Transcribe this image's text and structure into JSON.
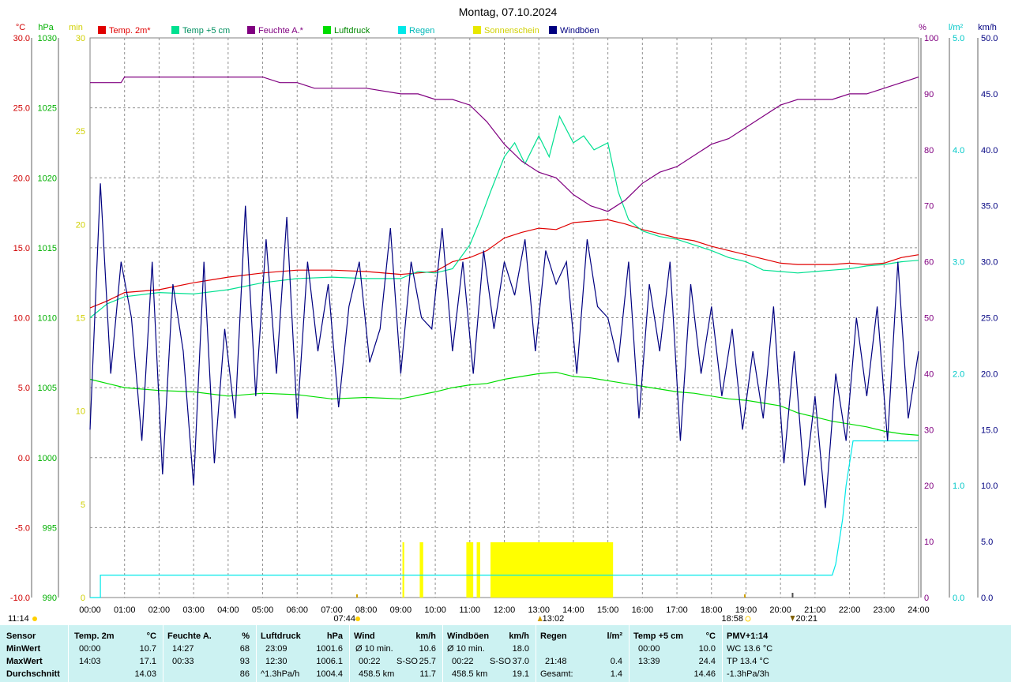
{
  "title": "Montag, 07.10.2024",
  "axis_units": {
    "temp": "°C",
    "pressure": "hPa",
    "sunshine": "min",
    "humidity": "%",
    "rain": "l/m²",
    "wind": "km/h"
  },
  "colors": {
    "temp2m": "#e00000",
    "temp5cm": "#00e090",
    "humidity": "#800080",
    "pressure": "#00dd00",
    "rain": "#00e8e8",
    "sunshine": "#ffff00",
    "wind": "#000080",
    "stats_bg": "#ccf2f2"
  },
  "chart_data": {
    "type": "line",
    "title": "Montag, 07.10.2024",
    "x_ticks": [
      "00:00",
      "01:00",
      "02:00",
      "03:00",
      "04:00",
      "05:00",
      "06:00",
      "07:00",
      "08:00",
      "09:00",
      "10:00",
      "11:00",
      "12:00",
      "13:00",
      "14:00",
      "15:00",
      "16:00",
      "17:00",
      "18:00",
      "19:00",
      "20:00",
      "21:00",
      "22:00",
      "23:00",
      "24:00"
    ],
    "xlim": [
      0,
      24
    ],
    "grid": true,
    "legend": [
      {
        "label": "Temp. 2m*",
        "color": "#e00000"
      },
      {
        "label": "Temp +5 cm",
        "color": "#00e090"
      },
      {
        "label": "Feuchte A.*",
        "color": "#800080"
      },
      {
        "label": "Luftdruck",
        "color": "#00dd00"
      },
      {
        "label": "Regen",
        "color": "#00e8e8"
      },
      {
        "label": "Sonnenschein",
        "color": "#e8e800"
      },
      {
        "label": "Windböen",
        "color": "#000080"
      }
    ],
    "axes": {
      "temp": {
        "unit": "°C",
        "ylim": [
          -10,
          30
        ],
        "ticks": [
          "30.0",
          "25.0",
          "20.0",
          "15.0",
          "10.0",
          "5.0",
          "0.0",
          "-5.0",
          "-10.0"
        ]
      },
      "pressure": {
        "unit": "hPa",
        "ylim": [
          990,
          1030
        ],
        "ticks": [
          "1030",
          "1025",
          "1020",
          "1015",
          "1010",
          "1005",
          "1000",
          "995",
          "990"
        ]
      },
      "sunshine": {
        "unit": "min",
        "ylim": [
          0,
          30
        ],
        "ticks": [
          "30",
          "25",
          "20",
          "15",
          "10",
          "5",
          "0"
        ]
      },
      "humidity": {
        "unit": "%",
        "ylim": [
          0,
          100
        ],
        "ticks": [
          "100",
          "90",
          "80",
          "70",
          "60",
          "50",
          "40",
          "30",
          "20",
          "10",
          "0"
        ]
      },
      "rain": {
        "unit": "l/m²",
        "ylim": [
          0,
          5
        ],
        "ticks": [
          "5.0",
          "4.0",
          "3.0",
          "2.0",
          "1.0",
          "0.0"
        ]
      },
      "wind": {
        "unit": "km/h",
        "ylim": [
          0,
          50
        ],
        "ticks": [
          "50.0",
          "45.0",
          "40.0",
          "35.0",
          "30.0",
          "25.0",
          "20.0",
          "15.0",
          "10.0",
          "5.0",
          "0.0"
        ]
      }
    },
    "series": [
      {
        "name": "Temp. 2m*",
        "axis": "temp",
        "x": [
          0,
          0.5,
          1,
          2,
          3,
          4,
          5,
          6,
          7,
          8,
          9,
          10,
          10.5,
          11,
          11.5,
          12,
          12.5,
          13,
          13.5,
          14,
          14.5,
          15,
          15.5,
          16,
          16.5,
          17,
          17.5,
          18,
          18.5,
          19,
          19.5,
          20,
          20.5,
          21,
          21.5,
          22,
          22.5,
          23,
          23.5,
          24
        ],
        "values": [
          10.7,
          11.2,
          11.8,
          12.0,
          12.5,
          12.9,
          13.2,
          13.4,
          13.4,
          13.3,
          13.1,
          13.3,
          14.0,
          14.3,
          14.8,
          15.7,
          16.1,
          16.4,
          16.3,
          16.8,
          16.9,
          17.0,
          16.7,
          16.3,
          16.0,
          15.7,
          15.5,
          15.1,
          14.8,
          14.5,
          14.2,
          13.9,
          13.8,
          13.8,
          13.8,
          13.9,
          13.8,
          13.9,
          14.3,
          14.5
        ]
      },
      {
        "name": "Temp +5 cm",
        "axis": "temp",
        "x": [
          0,
          0.5,
          1,
          2,
          3,
          4,
          5,
          6,
          7,
          8,
          9,
          9.5,
          10,
          10.5,
          11,
          11.3,
          11.6,
          12,
          12.3,
          12.6,
          13,
          13.3,
          13.6,
          14,
          14.3,
          14.6,
          15,
          15.3,
          15.6,
          16,
          16.5,
          17,
          17.5,
          18,
          18.5,
          19,
          19.5,
          20,
          20.5,
          21,
          21.5,
          22,
          22.5,
          23,
          23.5,
          24
        ],
        "values": [
          10.0,
          11.0,
          11.5,
          11.8,
          11.7,
          12.0,
          12.5,
          12.8,
          12.9,
          12.8,
          12.8,
          13.3,
          13.2,
          13.5,
          15.2,
          17.0,
          19.0,
          21.5,
          22.5,
          21.0,
          23.0,
          21.5,
          24.4,
          22.5,
          23.0,
          22.0,
          22.5,
          19.0,
          17.0,
          16.2,
          15.8,
          15.6,
          15.2,
          14.8,
          14.3,
          14.0,
          13.4,
          13.3,
          13.2,
          13.3,
          13.4,
          13.5,
          13.7,
          13.8,
          14.0,
          14.1
        ]
      },
      {
        "name": "Feuchte A.*",
        "axis": "humidity",
        "x": [
          0,
          0.5,
          0.9,
          1,
          2,
          3,
          4,
          5,
          5.5,
          6,
          6.5,
          7,
          8,
          9,
          9.5,
          10,
          10.5,
          11,
          11.5,
          12,
          12.5,
          13,
          13.5,
          14,
          14.5,
          15,
          15.5,
          16,
          16.5,
          17,
          17.5,
          18,
          18.5,
          19,
          19.5,
          20,
          20.5,
          21,
          21.5,
          22,
          22.5,
          23,
          23.5,
          24
        ],
        "values": [
          92,
          92,
          92,
          93,
          93,
          93,
          93,
          93,
          92,
          92,
          91,
          91,
          91,
          90,
          90,
          89,
          89,
          88,
          85,
          81,
          78,
          76,
          75,
          72,
          70,
          69,
          71,
          74,
          76,
          77,
          79,
          81,
          82,
          84,
          86,
          88,
          89,
          89,
          89,
          90,
          90,
          91,
          92,
          93
        ]
      },
      {
        "name": "Luftdruck",
        "axis": "pressure",
        "x": [
          0,
          0.5,
          1,
          2,
          3,
          4,
          5,
          6,
          7,
          8,
          9,
          10,
          10.5,
          11,
          11.5,
          12,
          12.5,
          13,
          13.5,
          14,
          14.5,
          15,
          15.5,
          16,
          16.5,
          17,
          17.5,
          18,
          18.5,
          19,
          19.5,
          20,
          20.5,
          21,
          21.5,
          22,
          22.5,
          23,
          23.5,
          24
        ],
        "values": [
          1005.6,
          1005.3,
          1005.0,
          1004.8,
          1004.7,
          1004.4,
          1004.6,
          1004.5,
          1004.2,
          1004.3,
          1004.2,
          1004.7,
          1005.0,
          1005.2,
          1005.3,
          1005.6,
          1005.8,
          1006.0,
          1006.1,
          1005.8,
          1005.7,
          1005.5,
          1005.3,
          1005.1,
          1004.9,
          1004.7,
          1004.6,
          1004.4,
          1004.2,
          1004.1,
          1003.9,
          1003.7,
          1003.2,
          1002.9,
          1002.6,
          1002.4,
          1002.2,
          1001.9,
          1001.7,
          1001.6
        ]
      },
      {
        "name": "Regen",
        "axis": "rain",
        "x": [
          0,
          0.3,
          0.3,
          21.5,
          21.6,
          21.7,
          21.8,
          21.9,
          22.0,
          22.1,
          24
        ],
        "values": [
          0,
          0,
          0.2,
          0.2,
          0.3,
          0.5,
          0.7,
          1.0,
          1.2,
          1.4,
          1.4
        ]
      },
      {
        "name": "Windböen",
        "axis": "wind",
        "x": [
          0,
          0.3,
          0.6,
          0.9,
          1.2,
          1.5,
          1.8,
          2.1,
          2.4,
          2.7,
          3.0,
          3.3,
          3.6,
          3.9,
          4.2,
          4.5,
          4.8,
          5.1,
          5.4,
          5.7,
          6.0,
          6.3,
          6.6,
          6.9,
          7.2,
          7.5,
          7.8,
          8.1,
          8.4,
          8.7,
          9.0,
          9.3,
          9.6,
          9.9,
          10.2,
          10.5,
          10.8,
          11.1,
          11.4,
          11.7,
          12.0,
          12.3,
          12.6,
          12.9,
          13.2,
          13.5,
          13.8,
          14.1,
          14.4,
          14.7,
          15.0,
          15.3,
          15.6,
          15.9,
          16.2,
          16.5,
          16.8,
          17.1,
          17.4,
          17.7,
          18.0,
          18.3,
          18.6,
          18.9,
          19.2,
          19.5,
          19.8,
          20.1,
          20.4,
          20.7,
          21.0,
          21.3,
          21.6,
          21.9,
          22.2,
          22.5,
          22.8,
          23.1,
          23.4,
          23.7,
          24
        ],
        "values": [
          15,
          37,
          20,
          30,
          25,
          14,
          30,
          11,
          28,
          22,
          10,
          30,
          12,
          24,
          16,
          35,
          18,
          32,
          20,
          34,
          16,
          30,
          22,
          28,
          17,
          26,
          30,
          21,
          24,
          33,
          20,
          30,
          25,
          24,
          33,
          22,
          30,
          20,
          31,
          24,
          30,
          27,
          32,
          22,
          31,
          28,
          30,
          20,
          32,
          26,
          25,
          21,
          30,
          16,
          28,
          22,
          30,
          14,
          28,
          20,
          26,
          18,
          24,
          15,
          22,
          16,
          26,
          12,
          22,
          10,
          18,
          8,
          20,
          14,
          25,
          18,
          26,
          14,
          30,
          16,
          22
        ]
      }
    ],
    "sunshine": {
      "axis": "sunshine",
      "x_ranges": [
        [
          9.05,
          9.1
        ],
        [
          9.55,
          9.65
        ],
        [
          10.9,
          11.1
        ],
        [
          11.2,
          11.3
        ],
        [
          11.6,
          15.15
        ]
      ],
      "value": 1
    },
    "markers": {
      "sunrise": "07:44",
      "sunset": "18:58",
      "noon": "13:02",
      "moon": "20:21"
    }
  },
  "stats": {
    "header": {
      "sensor": "Sensor",
      "temp2m": "Temp. 2m",
      "temp2m_unit": "°C",
      "humidity": "Feuchte A.",
      "humidity_unit": "%",
      "pressure": "Luftdruck",
      "pressure_unit": "hPa",
      "wind": "Wind",
      "wind_unit": "km/h",
      "gust": "Windböen",
      "gust_unit": "km/h",
      "rain": "Regen",
      "rain_unit": "l/m²",
      "temp5": "Temp +5 cm",
      "temp5_unit": "°C",
      "pmv": "PMV+1:14"
    },
    "rows": {
      "min": "MinWert",
      "max": "MaxWert",
      "avg": "Durchschnitt"
    },
    "temp2m": {
      "min_time": "00:00",
      "min": "10.7",
      "max_time": "14:03",
      "max": "17.1",
      "avg": "14.03"
    },
    "humidity": {
      "min_time": "14:27",
      "min": "68",
      "max_time": "00:33",
      "max": "93",
      "avg": "86"
    },
    "pressure": {
      "min_time": "23:09",
      "min": "1001.6",
      "max_time": "12:30",
      "max": "1006.1",
      "trend": "^1.3hPa/h",
      "avg": "1004.4"
    },
    "wind": {
      "r1_label": "Ø 10 min.",
      "r1_val": "10.6",
      "r2_time": "00:22",
      "r2_dir": "S-SO",
      "r2_val": "25.7",
      "r3_label": "458.5 km",
      "r3_val": "11.7"
    },
    "gust": {
      "r1_label": "Ø 10 min.",
      "r1_val": "18.0",
      "r2_time": "00:22",
      "r2_dir": "S-SO",
      "r2_val": "37.0",
      "r3_label": "458.5 km",
      "r3_val": "19.1"
    },
    "rain": {
      "r2_time": "21:48",
      "r2_val": "0.4",
      "r3_label": "Gesamt:",
      "r3_val": "1.4"
    },
    "temp5": {
      "min_time": "00:00",
      "min": "10.0",
      "max_time": "13:39",
      "max": "24.4",
      "avg": "14.46"
    },
    "pmv": {
      "r1": "WC 13.6 °C",
      "r2": "TP 13.4 °C",
      "r3": "-1.3hPa/3h"
    }
  },
  "corner_time": "11:14"
}
